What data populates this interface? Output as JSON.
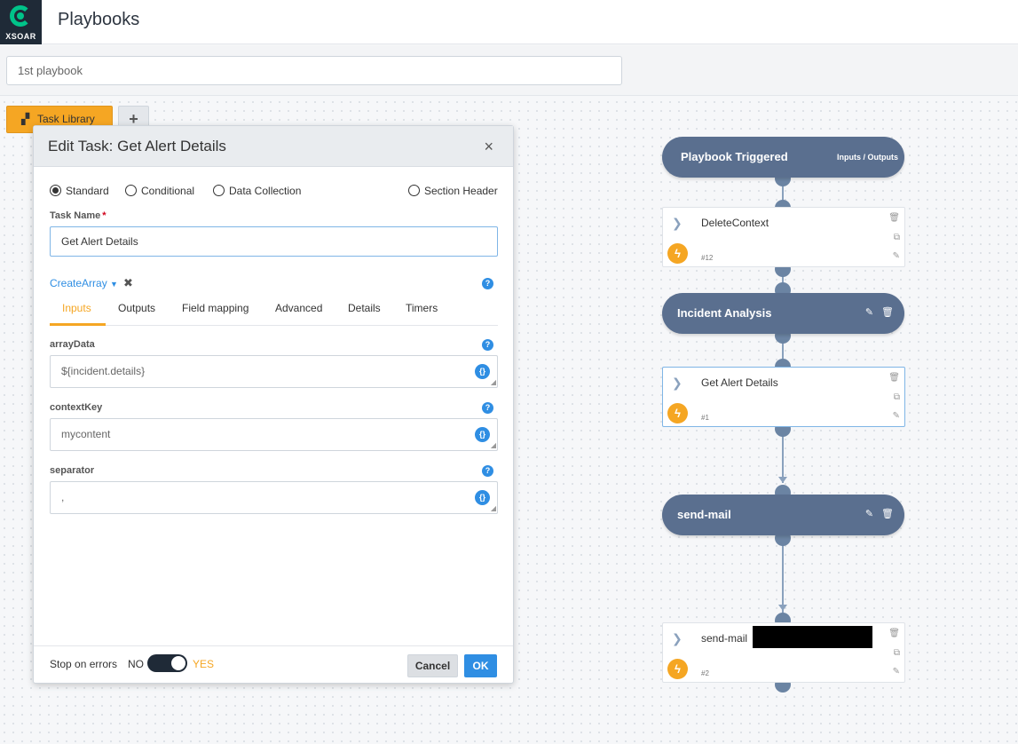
{
  "app": {
    "logo_text": "XSOAR",
    "page_title": "Playbooks"
  },
  "playbook_name": {
    "value": "1st playbook"
  },
  "toolbar": {
    "task_library_label": "Task Library",
    "add_label": "+"
  },
  "modal": {
    "title": "Edit Task: Get Alert Details",
    "close_label": "×",
    "task_types": [
      {
        "label": "Standard",
        "selected": true
      },
      {
        "label": "Conditional",
        "selected": false
      },
      {
        "label": "Data Collection",
        "selected": false
      },
      {
        "label": "Section Header",
        "selected": false
      }
    ],
    "task_name_label": "Task Name",
    "task_name_required": "*",
    "task_name_value": "Get Alert Details",
    "script_name": "CreateArray",
    "script_remove": "✖",
    "help_icon": "?",
    "tabs": [
      {
        "label": "Inputs",
        "active": true
      },
      {
        "label": "Outputs",
        "active": false
      },
      {
        "label": "Field mapping",
        "active": false
      },
      {
        "label": "Advanced",
        "active": false
      },
      {
        "label": "Details",
        "active": false
      },
      {
        "label": "Timers",
        "active": false
      }
    ],
    "inputs": [
      {
        "label": "arrayData",
        "value": "${incident.details}"
      },
      {
        "label": "contextKey",
        "value": "mycontent"
      },
      {
        "label": "separator",
        "value": ","
      }
    ],
    "code_icon": "{}",
    "footer": {
      "stop_on_errors_label": "Stop on errors",
      "no_label": "NO",
      "yes_label": "YES",
      "stop_on_errors_value": "YES",
      "cancel_label": "Cancel",
      "ok_label": "OK"
    }
  },
  "flow": {
    "trigger": {
      "title": "Playbook Triggered",
      "link": "Inputs / Outputs"
    },
    "tasks": [
      {
        "name": "DeleteContext",
        "number": "#12"
      },
      {
        "name": "Get Alert Details",
        "number": "#1"
      },
      {
        "name": "send-mail",
        "number": "#2"
      }
    ],
    "sections": [
      {
        "title": "Incident Analysis"
      },
      {
        "title": "send-mail"
      }
    ]
  },
  "colors": {
    "accent": "#f5a623",
    "primary": "#2f8ee3",
    "section": "#5a6f8f",
    "brand": "#00c389"
  }
}
